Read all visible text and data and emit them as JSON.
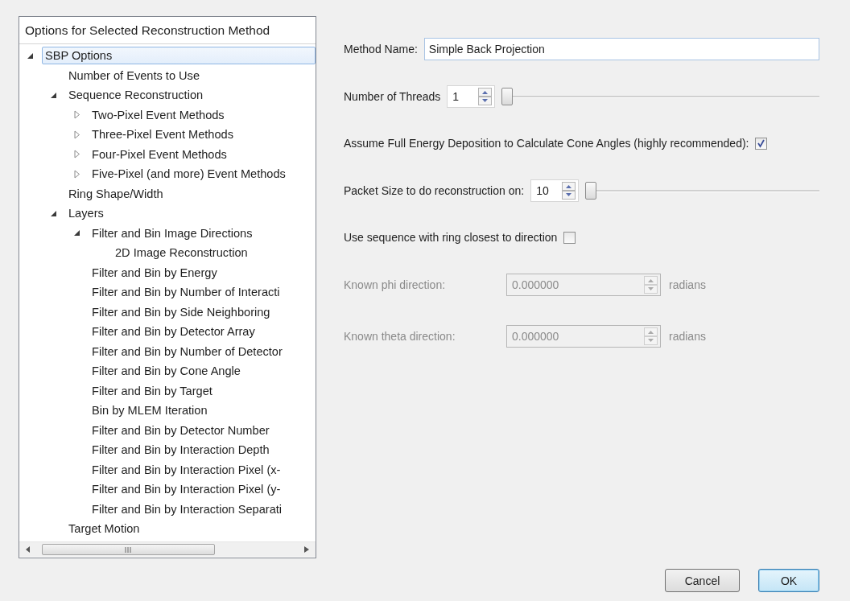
{
  "tree": {
    "title": "Options for Selected Reconstruction Method",
    "items": [
      {
        "label": "SBP Options",
        "expanded": true,
        "selected": true,
        "children": [
          {
            "label": "Number of Events to Use",
            "selected": false
          },
          {
            "label": "Sequence Reconstruction",
            "expanded": true,
            "selected": false,
            "children": [
              {
                "label": "Two-Pixel Event Methods",
                "expanded": false,
                "selected": false
              },
              {
                "label": "Three-Pixel Event Methods",
                "expanded": false,
                "selected": false
              },
              {
                "label": "Four-Pixel Event Methods",
                "expanded": false,
                "selected": false
              },
              {
                "label": "Five-Pixel (and more) Event Methods",
                "expanded": false,
                "selected": false
              }
            ]
          },
          {
            "label": "Ring Shape/Width",
            "selected": false
          },
          {
            "label": "Layers",
            "expanded": true,
            "selected": false,
            "children": [
              {
                "label": "Filter and Bin Image Directions",
                "expanded": true,
                "selected": false,
                "children": [
                  {
                    "label": "2D Image Reconstruction",
                    "selected": false
                  }
                ]
              },
              {
                "label": "Filter and Bin by Energy",
                "selected": false
              },
              {
                "label": "Filter and Bin by Number of Interacti",
                "selected": false
              },
              {
                "label": "Filter and Bin by Side Neighboring",
                "selected": false
              },
              {
                "label": "Filter and Bin by Detector Array",
                "selected": false
              },
              {
                "label": "Filter and Bin by Number of Detector",
                "selected": false
              },
              {
                "label": "Filter and Bin by Cone Angle",
                "selected": false
              },
              {
                "label": "Filter and Bin by Target",
                "selected": false
              },
              {
                "label": "Bin by MLEM Iteration",
                "selected": false
              },
              {
                "label": "Filter and Bin by Detector Number",
                "selected": false
              },
              {
                "label": "Filter and Bin by Interaction Depth",
                "selected": false
              },
              {
                "label": "Filter and Bin by Interaction Pixel (x-",
                "selected": false
              },
              {
                "label": "Filter and Bin by Interaction Pixel (y-",
                "selected": false
              },
              {
                "label": "Filter and Bin by Interaction Separati",
                "selected": false
              }
            ]
          },
          {
            "label": "Target Motion",
            "selected": false
          }
        ]
      }
    ]
  },
  "form": {
    "fields": [
      {
        "kind": "text",
        "label": "Method Name:",
        "value": "Simple Back Projection",
        "disabled": false
      },
      {
        "kind": "spin_slider",
        "label": "Number of Threads",
        "value": "1",
        "level": 0,
        "disabled": false
      },
      {
        "kind": "checkbox",
        "label": "Assume Full Energy Deposition to Calculate Cone Angles (highly recommended):",
        "checked": true,
        "disabled": false
      },
      {
        "kind": "spin_slider",
        "label": "Packet Size to do reconstruction on:",
        "value": "10",
        "level": 0,
        "disabled": false
      },
      {
        "kind": "checkbox",
        "label": "Use sequence with ring closest to direction",
        "checked": false,
        "disabled": false
      },
      {
        "kind": "spin_unit",
        "label": "Known phi direction:",
        "value": "0.000000",
        "unit": "radians",
        "disabled": true
      },
      {
        "kind": "spin_unit",
        "label": "Known theta direction:",
        "value": "0.000000",
        "unit": "radians",
        "disabled": true
      }
    ]
  },
  "buttons": [
    {
      "label": "Cancel",
      "default": false
    },
    {
      "label": "OK",
      "default": true
    }
  ]
}
